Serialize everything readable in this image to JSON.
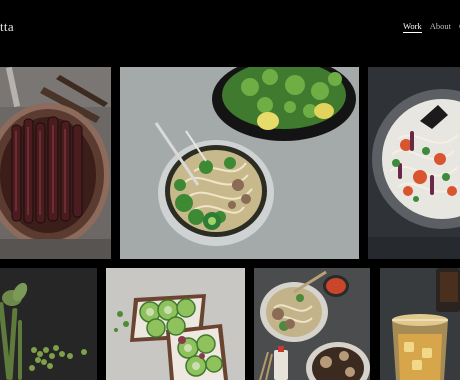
{
  "site": {
    "name": "tta"
  },
  "nav": {
    "items": [
      "Work",
      "About",
      "Co"
    ],
    "active": "Work"
  },
  "photos": [
    "eggplant-pan-photo",
    "noodle-soup-bowl-photo",
    "seafood-pasta-plate-photo",
    "green-beans-peas-photo",
    "cucumber-toast-photo",
    "ramen-bowls-photo",
    "cocktail-drinks-photo"
  ]
}
